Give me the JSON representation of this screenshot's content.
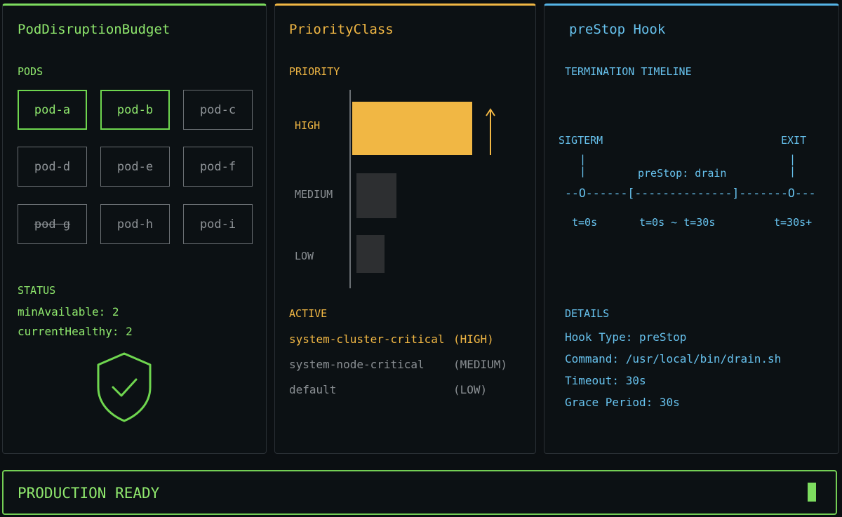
{
  "colors": {
    "green": "#7ddc5f",
    "amber": "#f1b744",
    "blue": "#55b4e6",
    "bar_inactive": "#2d2f31",
    "background": "#0b0f12"
  },
  "pdb": {
    "title": "PodDisruptionBudget",
    "pods_heading": "PODS",
    "pods": [
      {
        "name": "pod-a",
        "state": "healthy"
      },
      {
        "name": "pod-b",
        "state": "healthy"
      },
      {
        "name": "pod-c",
        "state": "idle"
      },
      {
        "name": "pod-d",
        "state": "idle"
      },
      {
        "name": "pod-e",
        "state": "idle"
      },
      {
        "name": "pod-f",
        "state": "idle"
      },
      {
        "name": "pod g",
        "state": "struck"
      },
      {
        "name": "pod-h",
        "state": "idle"
      },
      {
        "name": "pod-i",
        "state": "idle"
      }
    ],
    "status_heading": "STATUS",
    "min_available": "minAvailable: 2",
    "current_healthy": "currentHealthy: 2",
    "icon": "shield-check-icon"
  },
  "priority": {
    "title": "PriorityClass",
    "heading": "PRIORITY",
    "levels": [
      {
        "label": "HIGH",
        "value": 3,
        "active": true
      },
      {
        "label": "MEDIUM",
        "value": 1,
        "active": false
      },
      {
        "label": "LOW",
        "value": 0.7,
        "active": false
      }
    ],
    "arrow_icon": "arrow-up-icon",
    "active_heading": "ACTIVE",
    "classes": [
      {
        "name": "system-cluster-critical",
        "level": "(HIGH)",
        "active": true
      },
      {
        "name": "system-node-critical",
        "level": "(MEDIUM)",
        "active": false
      },
      {
        "name": "default",
        "level": "(LOW)",
        "active": false
      }
    ]
  },
  "prestop": {
    "title": "preStop Hook",
    "timeline_heading": "TERMINATION TIMELINE",
    "sigterm": "SIGTERM",
    "exit": "EXIT",
    "tick_left": "|\n|",
    "tick_right": "|\n|",
    "hook_label": "preStop: drain",
    "timeline_line": "--O------[--------------]-------O---",
    "t_start": "t=0s",
    "t_range": "t=0s ~ t=30s",
    "t_end": "t=30s+",
    "details_heading": "DETAILS",
    "details": [
      "Hook Type: preStop",
      "Command: /usr/local/bin/drain.sh",
      "Timeout: 30s",
      "Grace Period: 30s"
    ]
  },
  "footer": {
    "status": "PRODUCTION READY",
    "cursor_icon": "cursor-block-icon"
  }
}
